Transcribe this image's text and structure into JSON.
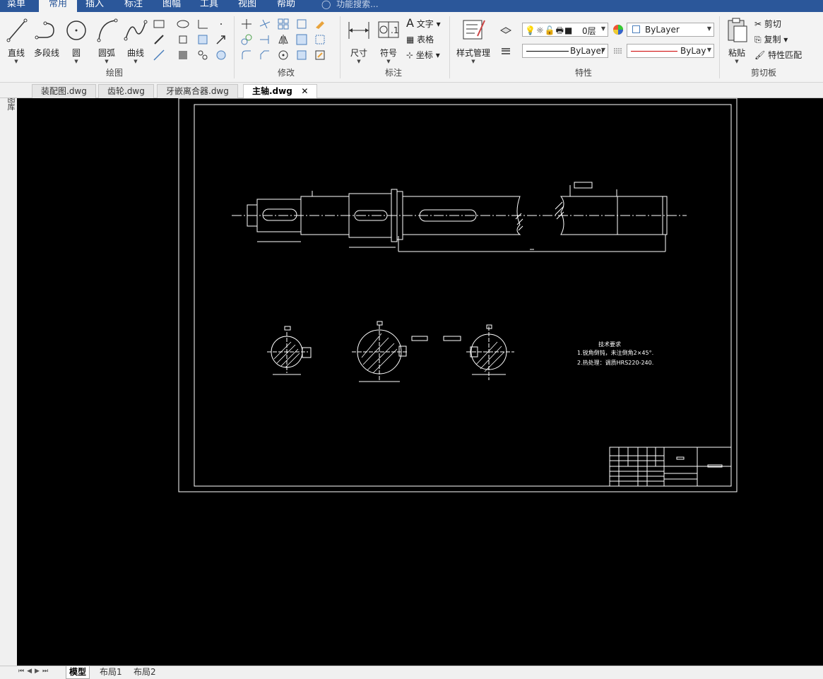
{
  "menu": {
    "items": [
      "菜单",
      "常用",
      "插入",
      "标注",
      "图幅",
      "工具",
      "视图",
      "帮助"
    ],
    "active_index": 1,
    "search_placeholder": "功能搜索..."
  },
  "ribbon": {
    "draw": {
      "label": "绘图",
      "line": "直线",
      "polyline": "多段线",
      "circle": "圆",
      "arc": "圆弧",
      "curve": "曲线"
    },
    "modify": {
      "label": "修改"
    },
    "annotate": {
      "label": "标注",
      "dimension": "尺寸",
      "symbol": "符号",
      "text": "文字",
      "table": "表格",
      "coordinate": "坐标"
    },
    "properties": {
      "label": "特性",
      "style_manager": "样式管理",
      "layer_name": "0层",
      "color_value": "ByLayer",
      "linetype_value": "ByLayer",
      "lineweight_value": "ByLay"
    },
    "clipboard": {
      "label": "剪切板",
      "paste": "粘贴",
      "cut": "剪切",
      "copy": "复制",
      "match": "特性匹配"
    }
  },
  "tabs": [
    {
      "label": "装配图.dwg",
      "active": false
    },
    {
      "label": "齿轮.dwg",
      "active": false
    },
    {
      "label": "牙嵌离合器.dwg",
      "active": false
    },
    {
      "label": "主轴.dwg",
      "active": true
    }
  ],
  "side_panel_label": "图库",
  "drawing": {
    "tech_title": "技术要求",
    "tech_line1": "1.锐角倒钝，未注倒角2×45°.",
    "tech_line2": "2.热处理：调质HRS220-240."
  },
  "layout_tabs": [
    "模型",
    "布局1",
    "布局2"
  ],
  "colors": {
    "accent": "#2b579a",
    "canvas": "#000000"
  }
}
